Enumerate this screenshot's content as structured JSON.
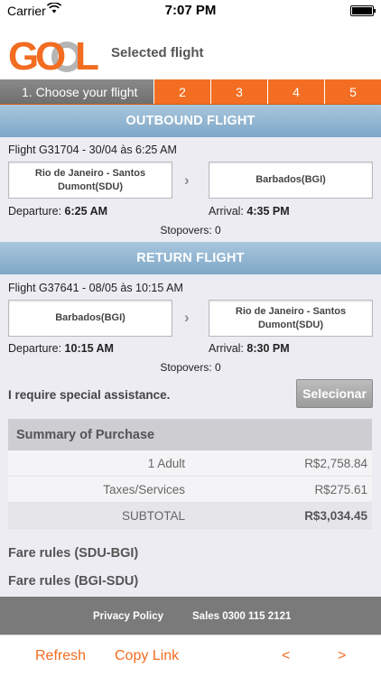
{
  "status_bar": {
    "carrier": "Carrier",
    "time": "7:07 PM"
  },
  "header": {
    "logo_text": "GOL",
    "title": "Selected flight"
  },
  "steps": [
    {
      "label": "1. Choose your flight"
    },
    {
      "label": "2"
    },
    {
      "label": "3"
    },
    {
      "label": "4"
    },
    {
      "label": "5"
    }
  ],
  "outbound": {
    "section_title": "OUTBOUND FLIGHT",
    "flight_info": "Flight G31704 - 30/04 às 6:25 AM",
    "origin": "Rio de Janeiro - Santos Dumont(SDU)",
    "destination": "Barbados(BGI)",
    "departure_label": "Departure:",
    "departure_time": "6:25 AM",
    "arrival_label": "Arrival:",
    "arrival_time": "4:35 PM",
    "stopovers": "Stopovers: 0"
  },
  "return": {
    "section_title": "RETURN FLIGHT",
    "flight_info": "Flight G37641 - 08/05 às 10:15 AM",
    "origin": "Barbados(BGI)",
    "destination": "Rio de Janeiro - Santos Dumont(SDU)",
    "departure_label": "Departure:",
    "departure_time": "10:15 AM",
    "arrival_label": "Arrival:",
    "arrival_time": "8:30 PM",
    "stopovers": "Stopovers: 0"
  },
  "assistance": {
    "label": "I require special assistance.",
    "button": "Selecionar"
  },
  "summary": {
    "title": "Summary of Purchase",
    "rows": [
      {
        "label": "1 Adult",
        "value": "R$2,758.84"
      },
      {
        "label": "Taxes/Services",
        "value": "R$275.61"
      },
      {
        "label": "SUBTOTAL",
        "value": "R$3,034.45"
      }
    ]
  },
  "fare_rules": [
    "Fare rules (SDU-BGI)",
    "Fare rules (BGI-SDU)"
  ],
  "footer": {
    "privacy": "Privacy Policy",
    "sales": "Sales 0300 115 2121"
  },
  "toolbar": {
    "refresh": "Refresh",
    "copy_link": "Copy Link",
    "back": "<",
    "forward": ">"
  },
  "colors": {
    "brand_orange": "#f26c21",
    "section_blue": "#8fb3d0",
    "footer_gray": "#7a7a7a"
  }
}
